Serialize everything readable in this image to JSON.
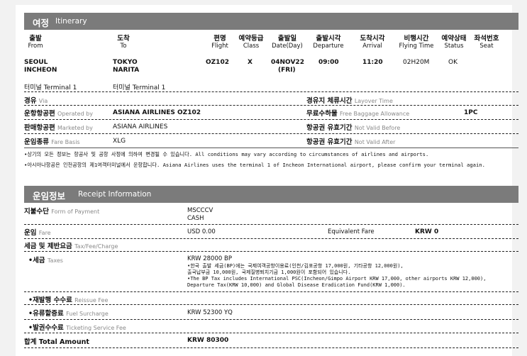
{
  "itinerary": {
    "title_ko": "여정",
    "title_en": "Itinerary",
    "headers": [
      {
        "ko": "출발",
        "en": "From"
      },
      {
        "ko": "도착",
        "en": "To"
      },
      {
        "ko": "편명",
        "en": "Flight"
      },
      {
        "ko": "예약등급",
        "en": "Class"
      },
      {
        "ko": "출발일",
        "en": "Date(Day)"
      },
      {
        "ko": "출발시각",
        "en": "Departure"
      },
      {
        "ko": "도착시각",
        "en": "Arrival"
      },
      {
        "ko": "비행시간",
        "en": "Flying Time"
      },
      {
        "ko": "예약상태",
        "en": "Status"
      },
      {
        "ko": "좌석번호",
        "en": "Seat"
      }
    ],
    "flight": {
      "from_city": "SEOUL",
      "from_airport": "INCHEON",
      "to_city": "TOKYO",
      "to_airport": "NARITA",
      "flight_no": "OZ102",
      "class": "X",
      "date": "04NOV22",
      "day": "(FRI)",
      "departure": "09:00",
      "arrival": "11:20",
      "flying_time": "02H20M",
      "status": "OK",
      "seat": ""
    },
    "terminal_from": "터미널 Terminal 1",
    "terminal_to": "터미널 Terminal 1",
    "via_ko": "경유",
    "via_en": "Via",
    "layover_ko": "경유지 체류시간",
    "layover_en": "Layover Time",
    "operated_ko": "운항항공편",
    "operated_en": "Operated by",
    "operated_value": "ASIANA AIRLINES OZ102",
    "baggage_ko": "무료수하물",
    "baggage_en": "Free Baggage Allowance",
    "baggage_value": "1PC",
    "marketed_ko": "판매항공편",
    "marketed_en": "Marketed by",
    "marketed_value": "ASIANA AIRLINES",
    "nvb_ko": "항공권 유효기간",
    "nvb_en": "Not Valid Before",
    "fare_basis_ko": "운임종류",
    "fare_basis_en": "Fare Basis",
    "fare_basis_value": "XLG",
    "nva_ko": "항공권 유효기간",
    "nva_en": "Not Valid After",
    "note1": "•상기의 모든 정보는 항공사 및 공항 사정에 의하여 변경될 수 있습니다. All conditions may vary according to circumstances of airlines and airports.",
    "note2": "•아시아나항공은 인천공항의 제1여객터미널에서 운항합니다. Asiana Airlines uses the terminal 1 of Incheon International airport, please confirm your terminal again."
  },
  "receipt": {
    "title_ko": "운임정보",
    "title_en": "Receipt Information",
    "payment_ko": "지불수단",
    "payment_en": "Form of Payment",
    "payment_value1": "MSCCCV",
    "payment_value2": "CASH",
    "fare_ko": "운임",
    "fare_en": "Fare",
    "fare_value": "USD 0.00",
    "equiv_label": "Equivalent Fare",
    "equiv_value": "KRW 0",
    "taxes_head_ko": "세금 및 제반요금",
    "taxes_head_en": "Tax/Fee/Charge",
    "tax_ko": "•세금",
    "tax_en": "Taxes",
    "tax_value": "KRW 28000 BP",
    "tax_note_1": "•한국 출발 세금(BP)에는 국제여객공항이용료(인천/김포공항 17,000원, 기타공항 12,000원),",
    "tax_note_2": "출국납부금 10,000원, 국제질병퇴치기금 1,000원이 포함되어 있습니다.",
    "tax_note_3": "•The BP Tax includes International PSC(Incheon/Gimpo Airport KRW 17,000, other airports KRW 12,000),",
    "tax_note_4": "Departure Tax(KRW 10,000) and Global Disease Eradication Fund(KRW 1,000).",
    "reissue_ko": "•재발행 수수료",
    "reissue_en": "Reissue Fee",
    "fuel_ko": "•유류할증료",
    "fuel_en": "Fuel Surcharge",
    "fuel_value": "KRW 52300 YQ",
    "ticketing_ko": "•발권수수료",
    "ticketing_en": "Ticketing Service Fee",
    "total_ko": "합계",
    "total_en": "Total Amount",
    "total_value": "KRW 80300"
  }
}
